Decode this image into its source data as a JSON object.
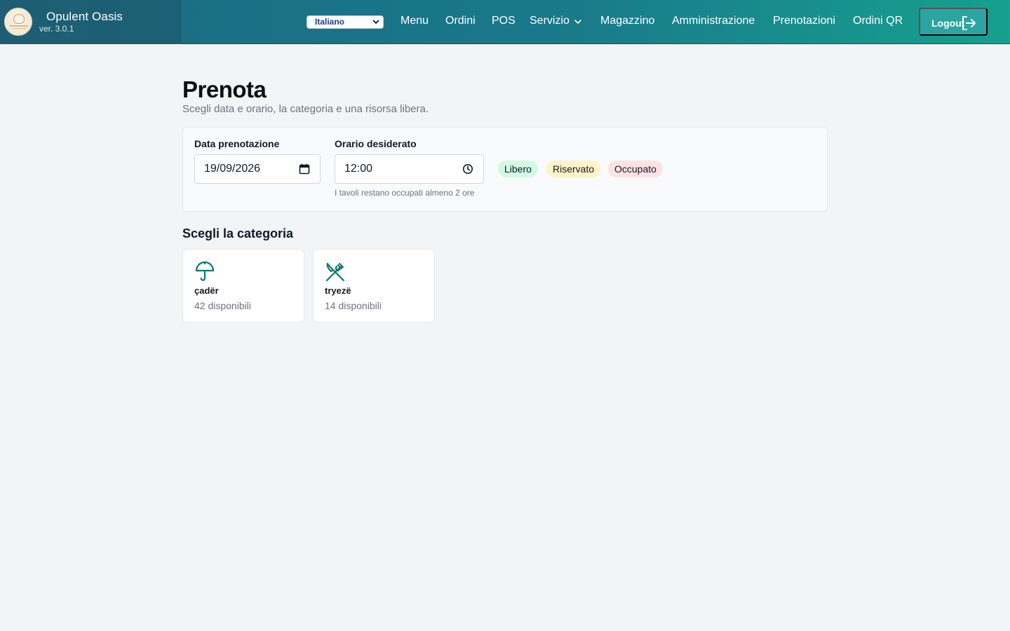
{
  "header": {
    "brand_name": "Opulent Oasis",
    "version": "ver. 3.0.1",
    "language": "Italiano",
    "nav": {
      "menu": "Menu",
      "ordini": "Ordini",
      "pos": "POS",
      "servizio": "Servizio",
      "magazzino": "Magazzino",
      "amministrazione": "Amministrazione",
      "prenotazioni": "Prenotazioni",
      "ordini_qr": "Ordini QR"
    },
    "logout_label": "Logout"
  },
  "page": {
    "title": "Prenota",
    "subtitle": "Scegli data e orario, la categoria e una risorsa libera."
  },
  "filters": {
    "date_label": "Data prenotazione",
    "date_value": "19/09/2026",
    "time_label": "Orario desiderato",
    "time_value": "12:00",
    "time_hint": "I tavoli restano occupati almeno 2 ore"
  },
  "legend": [
    {
      "label": "Libero",
      "color": "#d1fae5"
    },
    {
      "label": "Riservato",
      "color": "#fef3c7"
    },
    {
      "label": "Occupato",
      "color": "#fee2e2"
    }
  ],
  "categories_title": "Scegli la categoria",
  "categories": [
    {
      "name": "çadër",
      "available": "42 disponibili",
      "icon": "umbrella-icon"
    },
    {
      "name": "tryezë",
      "available": "14 disponibili",
      "icon": "utensils-icon"
    }
  ],
  "colors": {
    "accent": "#0f766e",
    "header_start": "#1a6a82",
    "header_end": "#16a08f"
  }
}
